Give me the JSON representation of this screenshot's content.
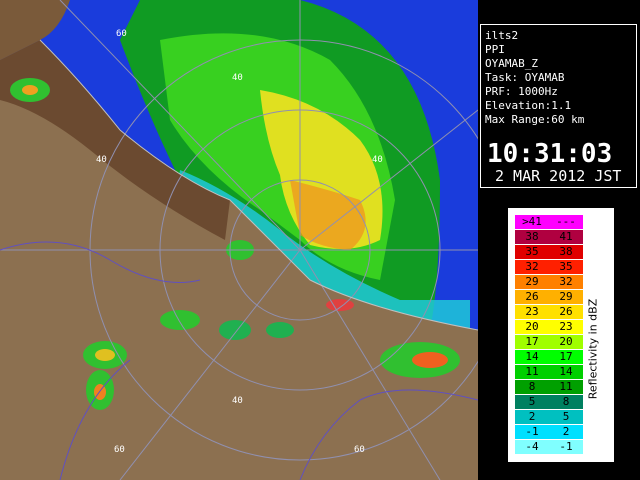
{
  "info": {
    "lines": [
      "ilts2",
      "PPI",
      "OYAMAB_Z",
      "Task: OYAMAB",
      "PRF: 1000Hz",
      "Elevation:1.1",
      "Max Range:60 km"
    ],
    "time": "10:31:03",
    "date": "2 MAR 2012 JST"
  },
  "legend": {
    "unit": "Reflectivity in dBZ",
    "bins": [
      {
        "lo": ">41",
        "hi": "---",
        "color": "#ff00ff"
      },
      {
        "lo": "38",
        "hi": "41",
        "color": "#b00040"
      },
      {
        "lo": "35",
        "hi": "38",
        "color": "#e00000"
      },
      {
        "lo": "32",
        "hi": "35",
        "color": "#ff2000"
      },
      {
        "lo": "29",
        "hi": "32",
        "color": "#ff8000"
      },
      {
        "lo": "26",
        "hi": "29",
        "color": "#ffb000"
      },
      {
        "lo": "23",
        "hi": "26",
        "color": "#ffe000"
      },
      {
        "lo": "20",
        "hi": "23",
        "color": "#ffff00"
      },
      {
        "lo": "17",
        "hi": "20",
        "color": "#a0ff00"
      },
      {
        "lo": "14",
        "hi": "17",
        "color": "#00ff00"
      },
      {
        "lo": "11",
        "hi": "14",
        "color": "#00d000"
      },
      {
        "lo": "8",
        "hi": "11",
        "color": "#00a000"
      },
      {
        "lo": "5",
        "hi": "8",
        "color": "#008060"
      },
      {
        "lo": "2",
        "hi": "5",
        "color": "#00c0c0"
      },
      {
        "lo": "-1",
        "hi": "2",
        "color": "#00e0ff"
      },
      {
        "lo": "-4",
        "hi": "-1",
        "color": "#80ffff"
      }
    ]
  },
  "map": {
    "range_ring_labels": [
      "60",
      "40",
      "40",
      "40",
      "40",
      "60",
      "60"
    ],
    "colors": {
      "sea": "#1a3cdc",
      "land": "#8c7050",
      "coast_land": "#6b4a30"
    }
  }
}
